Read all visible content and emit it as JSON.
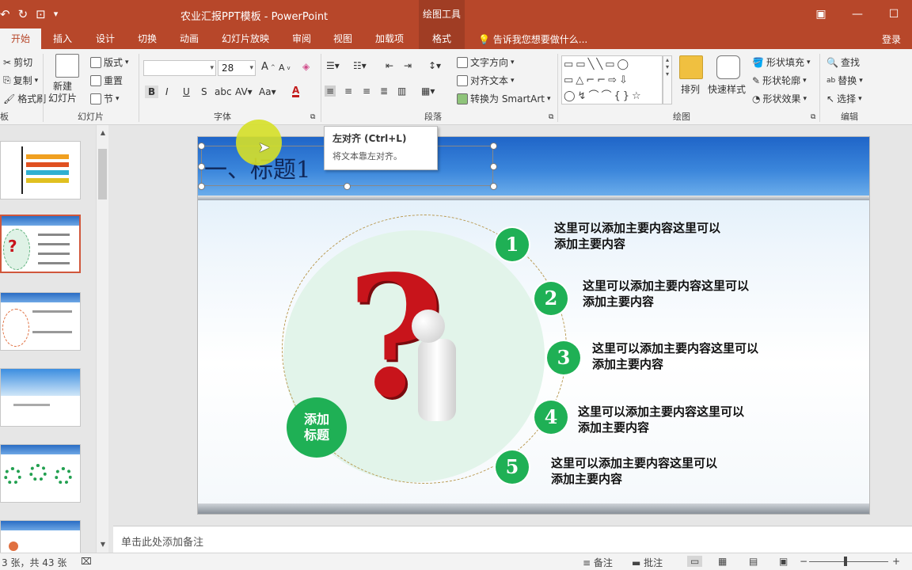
{
  "window": {
    "title": "农业汇报PPT模板 - PowerPoint",
    "context_tab_header": "绘图工具"
  },
  "qat": {
    "icons": [
      "undo-icon",
      "redo-icon",
      "present-icon",
      "customize-icon"
    ]
  },
  "tabs": [
    "开始",
    "插入",
    "设计",
    "切换",
    "动画",
    "幻灯片放映",
    "审阅",
    "视图",
    "加载项",
    "格式"
  ],
  "tellme": "告诉我您想要做什么...",
  "login": "登录",
  "ribbon": {
    "clipboard": {
      "cut": "剪切",
      "copy": "复制",
      "format_painter": "格式刷",
      "label": "板"
    },
    "slides": {
      "new_slide": "新建\n幻灯片",
      "layout": "版式",
      "reset": "重置",
      "section": "节",
      "label": "幻灯片"
    },
    "font": {
      "font_name": "",
      "font_size": "28",
      "bold": "B",
      "italic": "I",
      "underline": "U",
      "shadow": "S",
      "label": "字体"
    },
    "paragraph": {
      "text_direction": "文字方向",
      "align_text": "对齐文本",
      "smartart": "转换为 SmartArt",
      "label": "段落"
    },
    "drawing": {
      "arrange": "排列",
      "quick_styles": "快速样式",
      "shape_fill": "形状填充",
      "shape_outline": "形状轮廓",
      "shape_effects": "形状效果",
      "label": "绘图"
    },
    "editing": {
      "find": "查找",
      "replace": "替换",
      "select": "选择",
      "label": "编辑"
    }
  },
  "tooltip": {
    "title": "左对齐 (Ctrl+L)",
    "desc": "将文本靠左对齐。"
  },
  "slide": {
    "title": "一、标题1",
    "center_label_line1": "添加",
    "center_label_line2": "标题",
    "items": [
      {
        "num": "1",
        "line1": "这里可以添加主要内容这里可以",
        "line2": "添加主要内容"
      },
      {
        "num": "2",
        "line1": "这里可以添加主要内容这里可以",
        "line2": "添加主要内容"
      },
      {
        "num": "3",
        "line1": "这里可以添加主要内容这里可以",
        "line2": "添加主要内容"
      },
      {
        "num": "4",
        "line1": "这里可以添加主要内容这里可以",
        "line2": "添加主要内容"
      },
      {
        "num": "5",
        "line1": "这里可以添加主要内容这里可以",
        "line2": "添加主要内容"
      }
    ],
    "qmark": "?"
  },
  "notes_placeholder": "单击此处添加备注",
  "status": {
    "slide_count": "3 张，共 43 张",
    "notes": "备注",
    "comments": "批注"
  },
  "colors": {
    "accent": "#b7472a",
    "green": "#1fb055",
    "red": "#c8141b"
  }
}
